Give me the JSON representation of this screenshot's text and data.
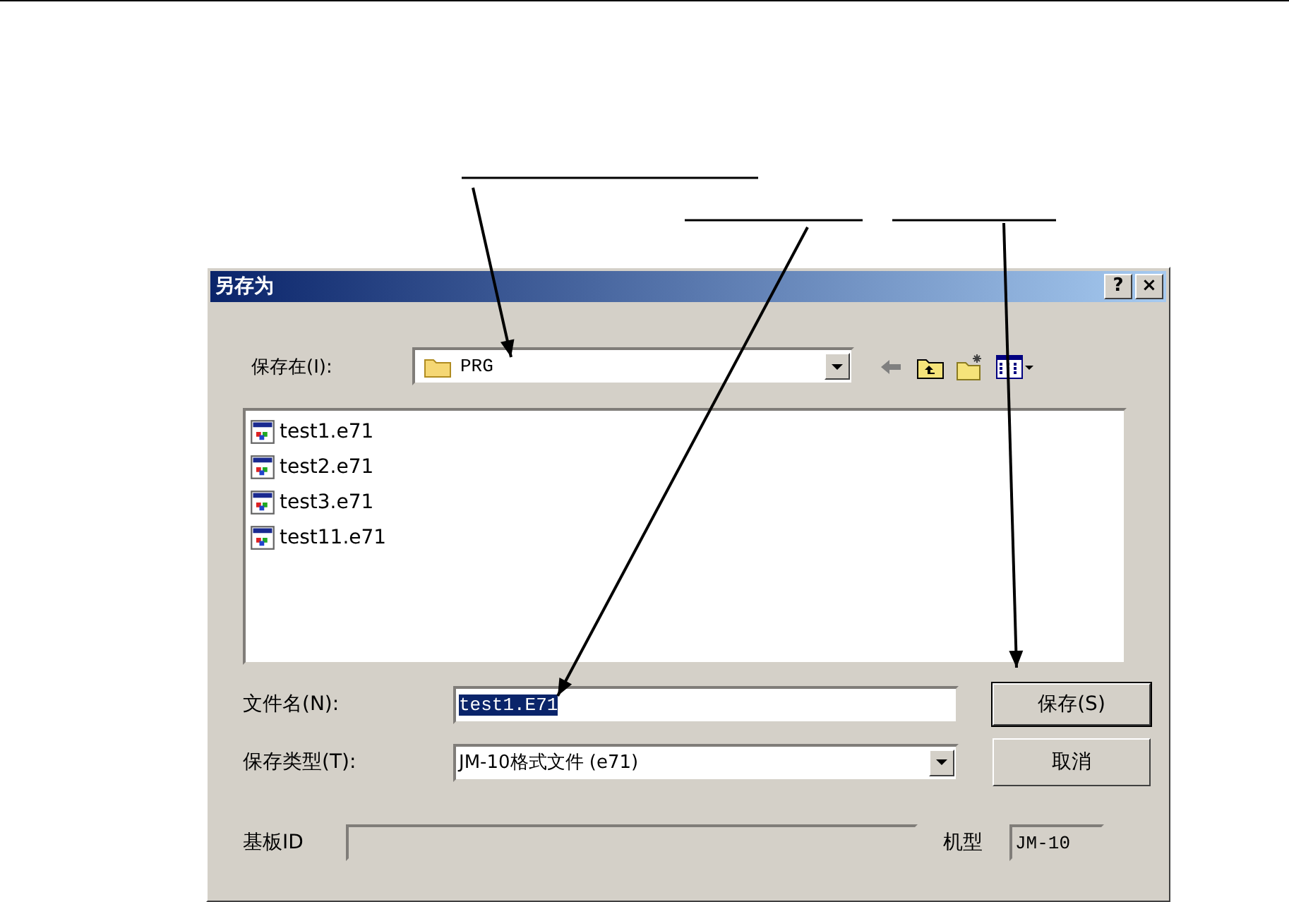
{
  "dialog": {
    "title": "另存为",
    "title_buttons": [
      "?",
      "×"
    ],
    "save_in": {
      "label": "保存在(I):",
      "value": "PRG"
    },
    "toolbar": [
      {
        "kind": "back",
        "disabled": true
      },
      {
        "kind": "up",
        "disabled": false
      },
      {
        "kind": "new_folder",
        "disabled": false
      },
      {
        "kind": "view",
        "disabled": false
      }
    ],
    "files": [
      {
        "name": "test1.e71"
      },
      {
        "name": "test2.e71"
      },
      {
        "name": "test3.e71"
      },
      {
        "name": "test11.e71"
      }
    ],
    "file_name": {
      "label": "文件名(N):",
      "value": "test1.E71",
      "text_selected": true
    },
    "file_type": {
      "label": "保存类型(T):",
      "value": "JM-10格式文件 (e71)"
    },
    "buttons": [
      {
        "label": "保存(S)",
        "default": true
      },
      {
        "label": "取消",
        "default": false
      }
    ],
    "board_id": {
      "label": "基板ID",
      "disabled": true
    },
    "model": {
      "label": "机型",
      "value": "JM-10"
    }
  }
}
